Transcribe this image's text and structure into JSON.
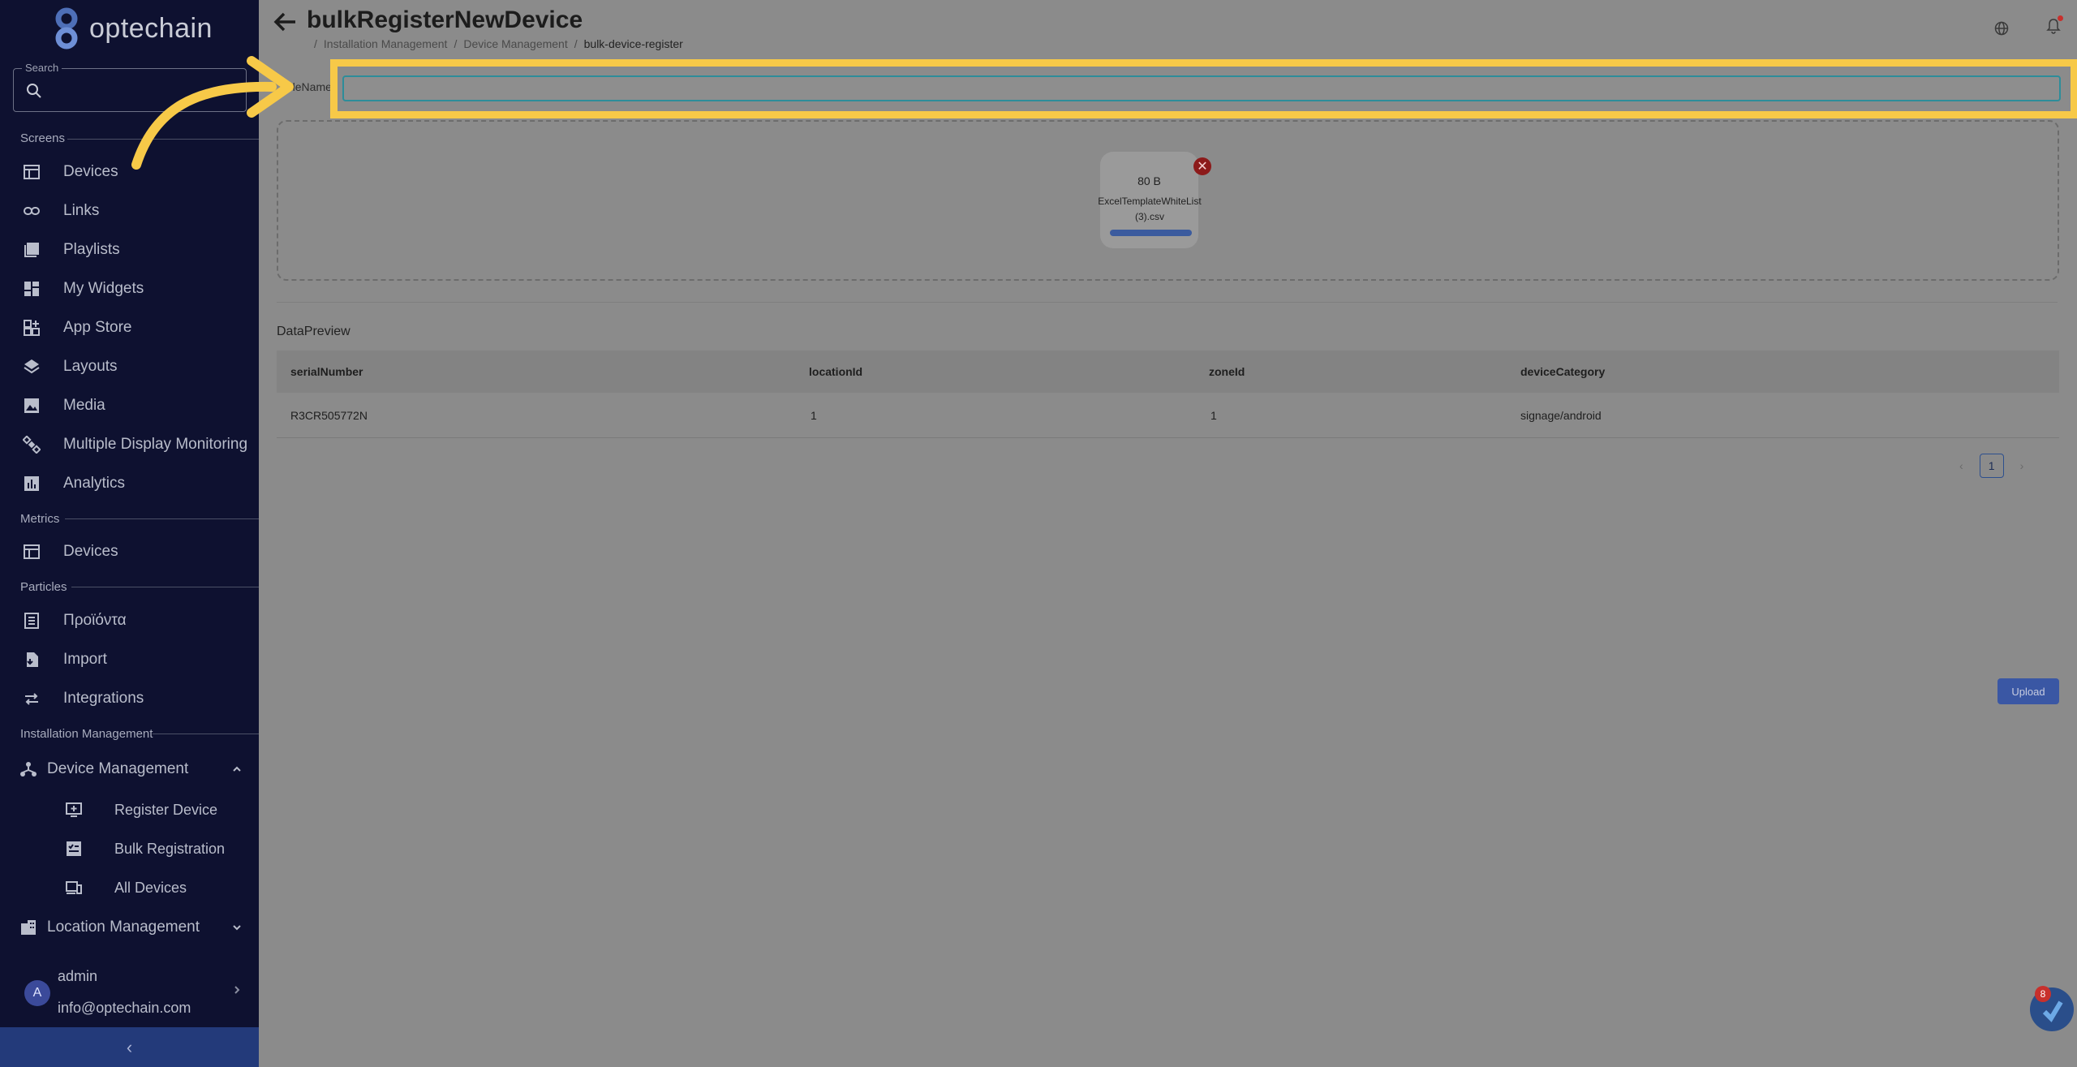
{
  "app": {
    "logo_text": "optechain"
  },
  "sidebar": {
    "search_legend": "Search",
    "sections": {
      "screens": "Screens",
      "metrics": "Metrics",
      "particles": "Particles",
      "installation": "Installation Management"
    },
    "screens_items": [
      {
        "label": "Devices",
        "icon": "table-icon"
      },
      {
        "label": "Links",
        "icon": "link-icon"
      },
      {
        "label": "Playlists",
        "icon": "playlist-add-icon"
      },
      {
        "label": "My Widgets",
        "icon": "dashboard-icon"
      },
      {
        "label": "App Store",
        "icon": "app-store-icon"
      },
      {
        "label": "Layouts",
        "icon": "layers-icon"
      },
      {
        "label": "Media",
        "icon": "image-icon"
      },
      {
        "label": "Multiple Display Monitoring",
        "icon": "satellite-icon"
      },
      {
        "label": "Analytics",
        "icon": "analytics-icon"
      }
    ],
    "metrics_items": [
      {
        "label": "Devices",
        "icon": "table-icon"
      }
    ],
    "particles_items": [
      {
        "label": "Προϊόντα",
        "icon": "receipt-icon"
      },
      {
        "label": "Import",
        "icon": "import-icon"
      },
      {
        "label": "Integrations",
        "icon": "swap-icon"
      }
    ],
    "device_management": {
      "label": "Device Management",
      "children": [
        {
          "label": "Register Device",
          "icon": "monitor-add-icon"
        },
        {
          "label": "Bulk Registration",
          "icon": "checklist-icon"
        },
        {
          "label": "All Devices",
          "icon": "devices-icon"
        }
      ]
    },
    "location_management": {
      "label": "Location Management"
    },
    "user": {
      "initial": "A",
      "name": "admin",
      "email": "info@optechain.com"
    },
    "collapse_glyph": "‹"
  },
  "header": {
    "title": "bulkRegisterNewDevice",
    "breadcrumb": [
      "Installation Management",
      "Device Management",
      "bulk-device-register"
    ],
    "breadcrumb_sep": "/"
  },
  "form": {
    "filename_label": "FileName",
    "filename_value": ""
  },
  "upload": {
    "file_size": "80 B",
    "file_name": "ExcelTemplateWhiteList (3).csv",
    "progress": 1.0,
    "remove_glyph": "✕"
  },
  "preview": {
    "title": "DataPreview",
    "columns": [
      "serialNumber",
      "locationId",
      "zoneId",
      "deviceCategory"
    ],
    "rows": [
      [
        "R3CR505772N",
        "1",
        "1",
        "signage/android"
      ]
    ],
    "pagination": {
      "prev": "‹",
      "current": "1",
      "next": "›"
    }
  },
  "actions": {
    "upload_label": "Upload"
  },
  "help": {
    "badge_count": "8"
  },
  "colors": {
    "sidebar_bg": "#0e1130",
    "accent": "#3a57a4",
    "highlight": "#f7c948",
    "danger": "#8c1a1a"
  }
}
